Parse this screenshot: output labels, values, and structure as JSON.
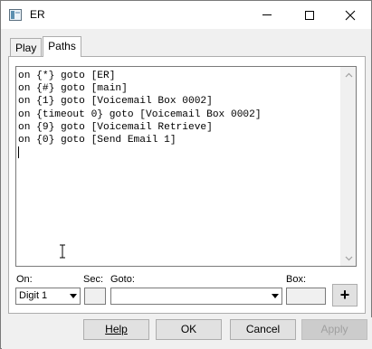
{
  "window": {
    "title": "ER",
    "icon": "app-window-icon"
  },
  "tabs": [
    {
      "label": "Play",
      "active": false
    },
    {
      "label": "Paths",
      "active": true
    }
  ],
  "editor": {
    "lines": [
      "on {*} goto [ER]",
      "on {#} goto [main]",
      "on {1} goto [Voicemail Box 0002]",
      "on {timeout 0} goto [Voicemail Box 0002]",
      "on {9} goto [Voicemail Retrieve]",
      "on {0} goto [Send Email 1]"
    ]
  },
  "form": {
    "on_label": "On:",
    "sec_label": "Sec:",
    "goto_label": "Goto:",
    "box_label": "Box:",
    "on_value": "Digit 1",
    "sec_value": "",
    "goto_value": "",
    "box_value": "",
    "add_label": "+"
  },
  "buttons": {
    "help_prefix": "",
    "help_label": "Help",
    "ok": "OK",
    "cancel": "Cancel",
    "apply": "Apply"
  }
}
